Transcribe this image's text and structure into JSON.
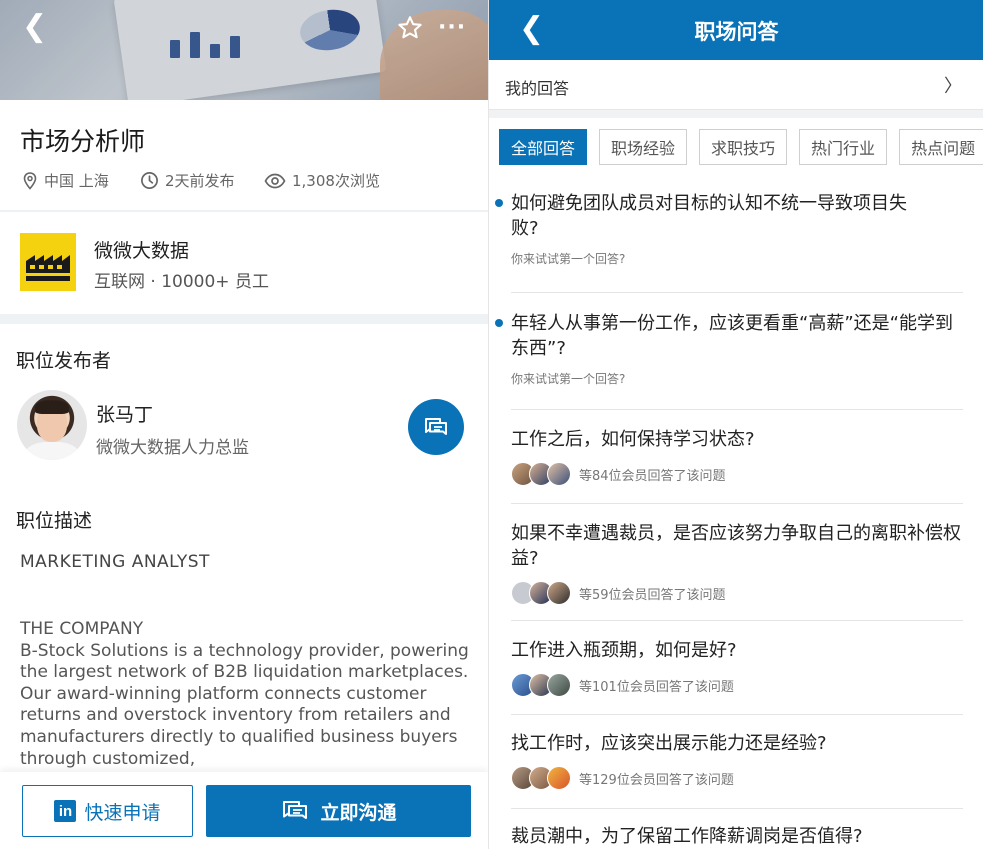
{
  "left": {
    "hero_more": "···",
    "job_title": "市场分析师",
    "location": "中国 上海",
    "posted": "2天前发布",
    "views": "1,308次浏览",
    "company": {
      "name": "微微大数据",
      "info": "互联网 · 10000+ 员工"
    },
    "poster_section": "职位发布者",
    "poster": {
      "name": "张马丁",
      "role": "微微大数据人力总监"
    },
    "description_section": "职位描述",
    "description_heading": "MARKETING ANALYST",
    "description_subheading": "THE COMPANY",
    "description_body": "B-Stock Solutions is a technology provider, powering the largest network of B2B liquidation marketplaces. Our award-winning platform connects customer returns and overstock inventory from retailers and manufacturers directly to qualified business buyers through customized,",
    "apply_label": "快速申请",
    "apply_logo": "in",
    "chat_label": "立即沟通"
  },
  "right": {
    "title": "职场问答",
    "my_answers": "我的回答",
    "my_answers_chevron": "〉",
    "filters": [
      "全部回答",
      "职场经验",
      "求职技巧",
      "热门行业",
      "热点问题"
    ],
    "questions": [
      {
        "text": "如何避免团队成员对目标的认知不统一导致项目失败?",
        "hint": "你来试试第一个回答?"
      },
      {
        "text": "年轻人从事第一份工作，应该更看重“高薪”还是“能学到东西”?",
        "hint": "你来试试第一个回答?"
      },
      {
        "text": "工作之后，如何保持学习状态?",
        "answered": "等84位会员回答了该问题"
      },
      {
        "text": "如果不幸遭遇裁员，是否应该努力争取自己的离职补偿权益?",
        "answered": "等59位会员回答了该问题"
      },
      {
        "text": "工作进入瓶颈期，如何是好?",
        "answered": "等101位会员回答了该问题"
      },
      {
        "text": "找工作时，应该突出展示能力还是经验?",
        "answered": "等129位会员回答了该问题"
      },
      {
        "text": "裁员潮中，为了保留工作降薪调岗是否值得?"
      }
    ]
  },
  "colors": {
    "accent": "#0a73b7",
    "logo_yellow": "#f5d20f"
  }
}
